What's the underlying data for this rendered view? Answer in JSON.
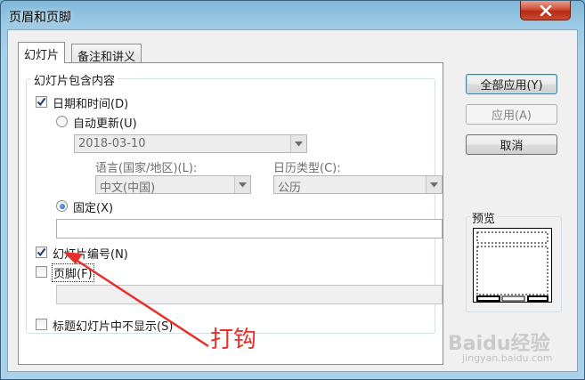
{
  "window": {
    "title": "页眉和页脚"
  },
  "tabs": [
    {
      "label": "幻灯片",
      "active": true
    },
    {
      "label": "备注和讲义",
      "active": false
    }
  ],
  "slide_contents": {
    "group_label": "幻灯片包含内容",
    "date_time": {
      "label": "日期和时间(D)",
      "checked": true
    },
    "auto_update": {
      "label": "自动更新(U)",
      "selected": false
    },
    "date_value": "2018-03-10",
    "language_label": "语言(国家/地区)(L):",
    "language_value": "中文(中国)",
    "calendar_label": "日历类型(C):",
    "calendar_value": "公历",
    "fixed": {
      "label": "固定(X)",
      "selected": true
    },
    "fixed_value": "",
    "slide_number": {
      "label": "幻灯片编号(N)",
      "checked": true
    },
    "footer": {
      "label": "页脚(F)",
      "checked": false
    },
    "footer_value": "",
    "hide_on_title": {
      "label": "标题幻灯片中不显示(S)",
      "checked": false
    }
  },
  "buttons": {
    "apply_all": "全部应用(Y)",
    "apply": "应用(A)",
    "cancel": "取消"
  },
  "preview": {
    "label": "预览"
  },
  "annotation": {
    "text": "打钩",
    "color": "#e8302a"
  },
  "watermark": {
    "brand": "Baidu经验",
    "url": "jingyan.baidu.com"
  },
  "colors": {
    "accent": "#3c7fb1",
    "close": "#c84b30"
  }
}
